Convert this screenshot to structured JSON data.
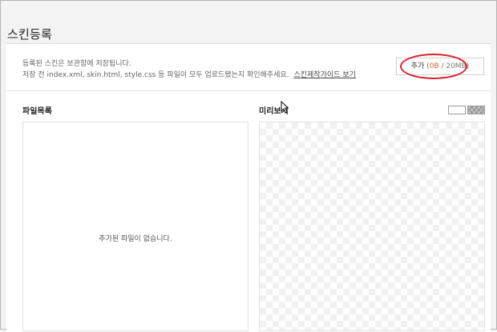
{
  "page": {
    "title": "스킨등록"
  },
  "notice": {
    "line1": "등록된 스킨은 보관함에 저장됩니다.",
    "line2": "저장 전 index.xml, skin.html, style.css 등 파일이 모두 업로드됐는지 확인해주세요.",
    "guide_link": "스킨제작가이드 보기"
  },
  "add_button": {
    "label": "추가",
    "open_paren": " (",
    "used": "0B",
    "separator": " / ",
    "limit": "20MB",
    "close_paren": ")"
  },
  "file_list": {
    "label": "파일목록",
    "empty_message": "추가된 파일이 없습니다."
  },
  "preview": {
    "label": "미리보기"
  },
  "colors": {
    "highlight_circle": "#e0202b",
    "used_size": "#e35d2c"
  }
}
